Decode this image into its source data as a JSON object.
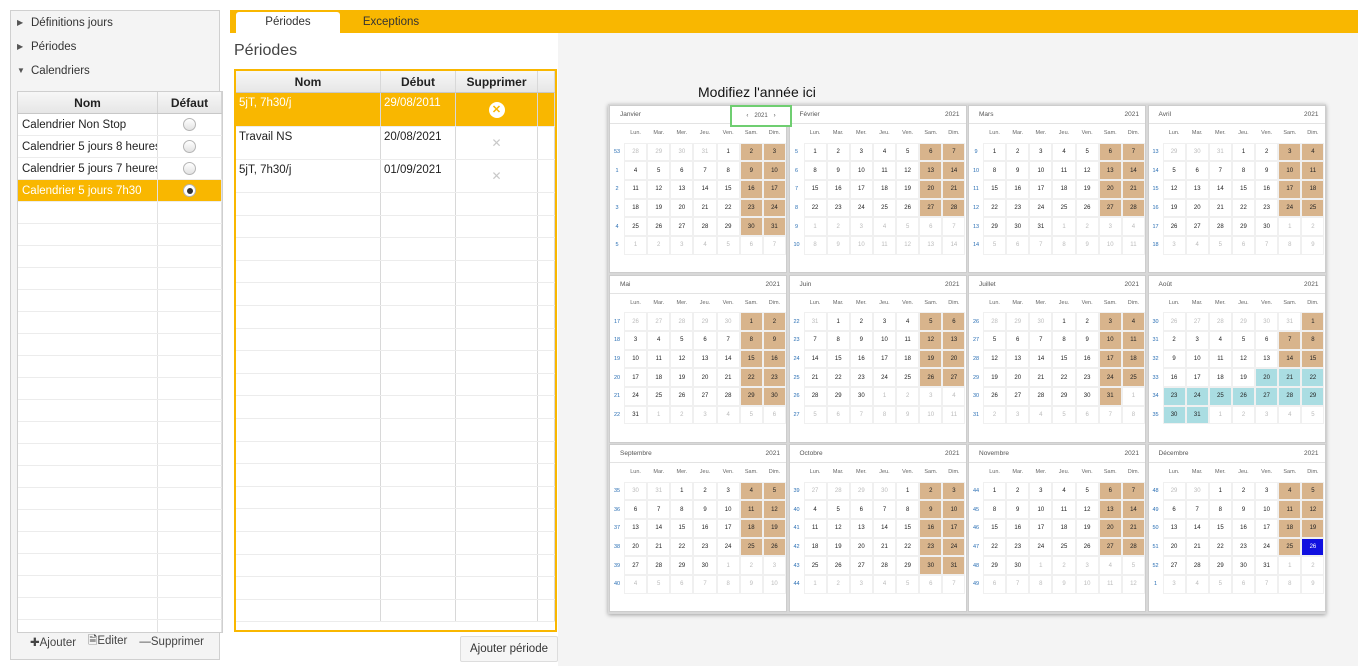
{
  "nav": {
    "items": [
      {
        "label": "Définitions jours",
        "expanded": false
      },
      {
        "label": "Périodes",
        "expanded": false
      },
      {
        "label": "Calendriers",
        "expanded": true
      }
    ],
    "calendar_table": {
      "headers": {
        "name": "Nom",
        "default": "Défaut"
      },
      "rows": [
        {
          "name": "Calendrier Non Stop",
          "default": false,
          "selected": false
        },
        {
          "name": "Calendrier 5 jours 8 heures",
          "default": false,
          "selected": false
        },
        {
          "name": "Calendrier 5 jours 7 heures",
          "default": false,
          "selected": false
        },
        {
          "name": "Calendrier 5 jours 7h30",
          "default": true,
          "selected": true
        }
      ]
    },
    "buttons": {
      "add": "Ajouter",
      "edit": "Editer",
      "delete": "Supprimer"
    }
  },
  "tabs": [
    {
      "label": "Périodes",
      "active": true
    },
    {
      "label": "Exceptions",
      "active": false
    }
  ],
  "periods": {
    "title": "Périodes",
    "headers": {
      "name": "Nom",
      "start": "Début",
      "delete": "Supprimer"
    },
    "rows": [
      {
        "name": "5jT, 7h30/j",
        "start": "29/08/2011",
        "selected": true
      },
      {
        "name": "Travail NS",
        "start": "20/08/2021",
        "selected": false
      },
      {
        "name": "5jT, 7h30/j",
        "start": "01/09/2021",
        "selected": false
      }
    ],
    "add_button": "Ajouter période"
  },
  "calendar": {
    "hint": "Modifiez l'année ici",
    "year": "2021",
    "day_headers": [
      "Lun.",
      "Mar.",
      "Mer.",
      "Jeu.",
      "Ven.",
      "Sam.",
      "Dim."
    ],
    "months": [
      {
        "name": "Janvier",
        "weeks": [
          53,
          1,
          2,
          3,
          4,
          5
        ],
        "first": "2020-12-28"
      },
      {
        "name": "Février",
        "weeks": [
          5,
          6,
          7,
          8,
          9,
          10
        ],
        "first": "2021-02-01"
      },
      {
        "name": "Mars",
        "weeks": [
          9,
          10,
          11,
          12,
          13,
          14
        ],
        "first": "2021-03-01"
      },
      {
        "name": "Avril",
        "weeks": [
          13,
          14,
          15,
          16,
          17,
          18
        ],
        "first": "2021-03-29"
      },
      {
        "name": "Mai",
        "weeks": [
          17,
          18,
          19,
          20,
          21,
          22
        ],
        "first": "2021-04-26"
      },
      {
        "name": "Juin",
        "weeks": [
          22,
          23,
          24,
          25,
          26,
          27
        ],
        "first": "2021-05-31"
      },
      {
        "name": "Juillet",
        "weeks": [
          26,
          27,
          28,
          29,
          30,
          31
        ],
        "first": "2021-06-28"
      },
      {
        "name": "Août",
        "weeks": [
          30,
          31,
          32,
          33,
          34,
          35
        ],
        "first": "2021-07-26"
      },
      {
        "name": "Septembre",
        "weeks": [
          35,
          36,
          37,
          38,
          39,
          40
        ],
        "first": "2021-08-30"
      },
      {
        "name": "Octobre",
        "weeks": [
          39,
          40,
          41,
          42,
          43,
          44
        ],
        "first": "2021-09-27"
      },
      {
        "name": "Novembre",
        "weeks": [
          44,
          45,
          46,
          47,
          48,
          49
        ],
        "first": "2021-11-01"
      },
      {
        "name": "Décembre",
        "weeks": [
          48,
          49,
          50,
          51,
          52,
          1
        ],
        "first": "2021-11-29"
      }
    ],
    "highlighted_range": {
      "from": "2021-08-20",
      "to": "2021-08-31"
    },
    "today": "2021-12-26",
    "colors": {
      "weekend": "#d8b48c",
      "highlight": "#aadde2",
      "today": "#1010e0",
      "accent": "#f9b700"
    }
  }
}
